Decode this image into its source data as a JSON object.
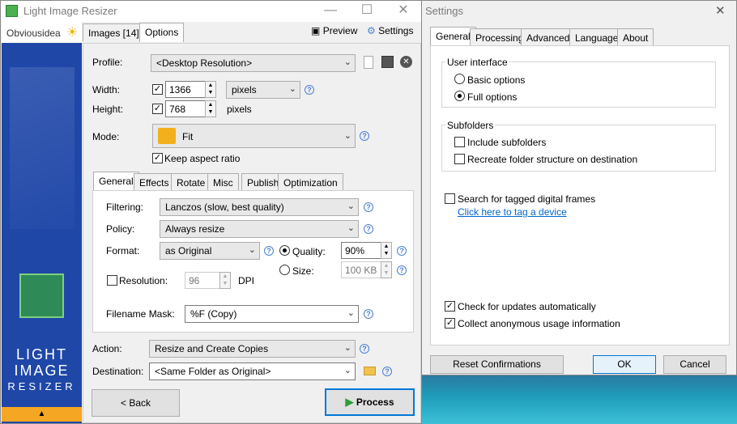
{
  "main": {
    "title": "Light Image Resizer",
    "brand": "Obviousidea",
    "tabs": {
      "images": "Images [14]",
      "options": "Options"
    },
    "preview": "Preview",
    "settings": "Settings",
    "profile": {
      "label": "Profile:",
      "value": "<Desktop Resolution>"
    },
    "width": {
      "label": "Width:",
      "value": "1366",
      "unit": "pixels"
    },
    "height": {
      "label": "Height:",
      "value": "768",
      "unit": "pixels"
    },
    "mode": {
      "label": "Mode:",
      "value": "Fit"
    },
    "keep_aspect": "Keep aspect ratio",
    "subtabs": [
      "General",
      "Effects",
      "Rotate",
      "Misc",
      "Publish",
      "Optimization"
    ],
    "filtering": {
      "label": "Filtering:",
      "value": "Lanczos  (slow, best quality)"
    },
    "policy": {
      "label": "Policy:",
      "value": "Always resize"
    },
    "format": {
      "label": "Format:",
      "value": "as Original"
    },
    "quality": {
      "label": "Quality:",
      "value": "90%"
    },
    "size": {
      "label": "Size:",
      "value": "100 KB"
    },
    "resolution": {
      "label": "Resolution:",
      "value": "96",
      "unit": "DPI"
    },
    "filename_mask": {
      "label": "Filename Mask:",
      "value": "%F (Copy)"
    },
    "action": {
      "label": "Action:",
      "value": "Resize and Create Copies"
    },
    "destination": {
      "label": "Destination:",
      "value": "<Same Folder as Original>"
    },
    "back": "< Back",
    "process": "Process",
    "sidebar_text": [
      "LIGHT",
      "IMAGE",
      "RESIZER"
    ]
  },
  "settings": {
    "title": "Settings",
    "tabs": [
      "General",
      "Processing",
      "Advanced",
      "Language",
      "About"
    ],
    "ui_group": "User interface",
    "basic": "Basic options",
    "full": "Full options",
    "sub_group": "Subfolders",
    "include": "Include subfolders",
    "recreate": "Recreate folder structure on destination",
    "tagged": "Search for tagged digital frames",
    "tag_link": "Click here to tag a device",
    "updates": "Check for updates automatically",
    "anon": "Collect anonymous usage information",
    "reset": "Reset Confirmations",
    "ok": "OK",
    "cancel": "Cancel"
  },
  "colors": {
    "accent": "#1f47a8",
    "link": "#0066cc",
    "process_border": "#0078d7"
  }
}
